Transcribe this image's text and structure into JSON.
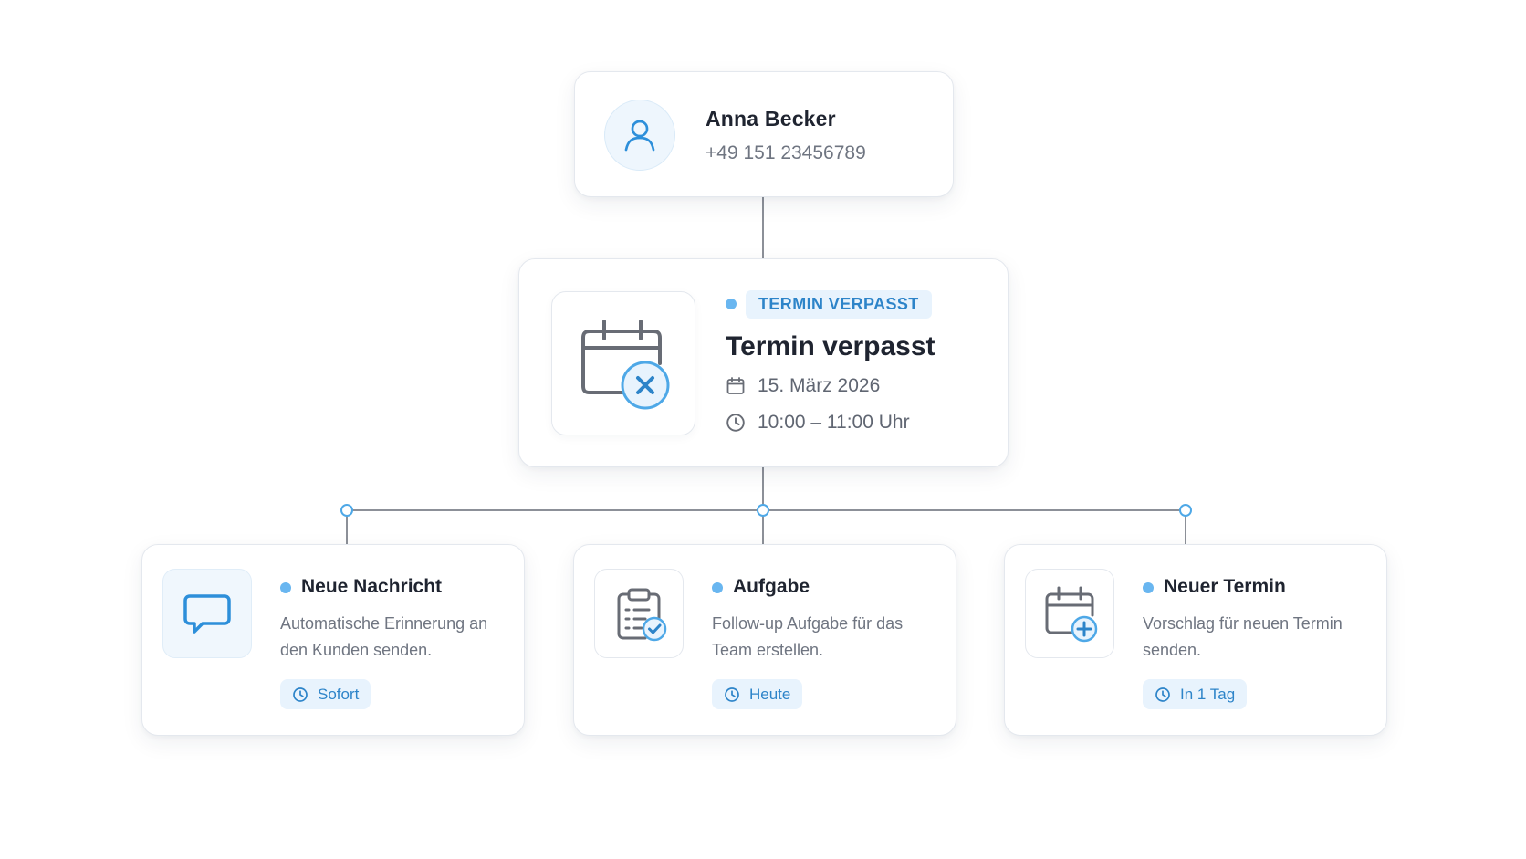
{
  "contact": {
    "name": "Anna Becker",
    "phone": "+49 151 23456789",
    "icon": "user-icon"
  },
  "event": {
    "badge": "TERMIN VERPASST",
    "title": "Termin verpasst",
    "date": "15. März 2026",
    "time": "10:00 – 11:00 Uhr",
    "icon": "calendar-cancel-icon"
  },
  "actions": [
    {
      "title": "Neue Nachricht",
      "description": "Automatische Erinnerung an den Kunden senden.",
      "timing": "Sofort",
      "icon": "chat-bubble-icon"
    },
    {
      "title": "Aufgabe",
      "description": "Follow-up Aufgabe für das Team erstellen.",
      "timing": "Heute",
      "icon": "clipboard-check-icon"
    },
    {
      "title": "Neuer Termin",
      "description": "Vorschlag für neuen Termin senden.",
      "timing": "In 1 Tag",
      "icon": "calendar-plus-icon"
    }
  ],
  "colors": {
    "accent": "#4ea8e7",
    "badge_text": "#2d84c9",
    "badge_background": "#e8f3fd",
    "connector": "#8c9098"
  }
}
